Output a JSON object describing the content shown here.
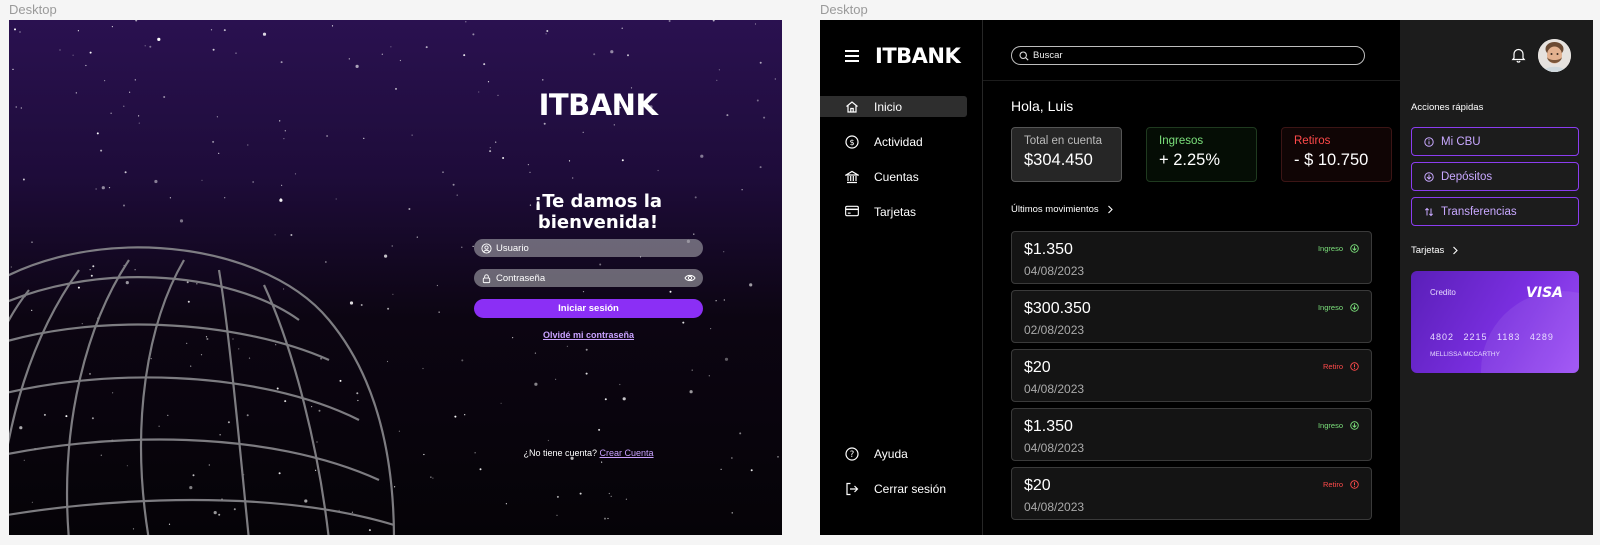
{
  "frames": {
    "left_label": "Desktop",
    "right_label": "Desktop"
  },
  "login": {
    "logo": "ITBANK",
    "welcome": "¡Te damos la bienvenida!",
    "user_placeholder": "Usuario",
    "password_placeholder": "Contraseña",
    "login_button": "Iniciar sesión",
    "forgot_link": "Olvidé mi contraseña",
    "signup_prompt": "¿No tiene cuenta?",
    "signup_link": "Crear Cuenta"
  },
  "dashboard": {
    "logo": "ITBANK",
    "search_placeholder": "Buscar",
    "nav": [
      {
        "label": "Inicio",
        "icon": "home-icon",
        "active": true
      },
      {
        "label": "Actividad",
        "icon": "dollar-circle-icon"
      },
      {
        "label": "Cuentas",
        "icon": "bank-icon"
      },
      {
        "label": "Tarjetas",
        "icon": "credit-card-icon"
      }
    ],
    "nav_bottom": [
      {
        "label": "Ayuda",
        "icon": "help-icon"
      },
      {
        "label": "Cerrar sesión",
        "icon": "logout-icon"
      }
    ],
    "greeting": "Hola, Luis",
    "stats": {
      "total": {
        "label": "Total en cuenta",
        "value": "$304.450"
      },
      "income": {
        "label": "Ingresos",
        "value": "+ 2.25%"
      },
      "withdrawals": {
        "label": "Retiros",
        "value": "- $ 10.750"
      }
    },
    "movements_title": "Últimos movimientos",
    "movements": [
      {
        "amount": "$1.350",
        "date": "04/08/2023",
        "type": "Ingreso"
      },
      {
        "amount": "$300.350",
        "date": "02/08/2023",
        "type": "Ingreso"
      },
      {
        "amount": "$20",
        "date": "04/08/2023",
        "type": "Retiro"
      },
      {
        "amount": "$1.350",
        "date": "04/08/2023",
        "type": "Ingreso"
      },
      {
        "amount": "$20",
        "date": "04/08/2023",
        "type": "Retiro"
      }
    ],
    "quick_actions_title": "Acciones rápidas",
    "quick_actions": [
      {
        "label": "Mi CBU",
        "icon": "info-icon"
      },
      {
        "label": "Depósitos",
        "icon": "deposit-icon"
      },
      {
        "label": "Transferencias",
        "icon": "transfer-icon"
      }
    ],
    "cards_title": "Tarjetas",
    "card": {
      "type": "Credito",
      "brand": "VISA",
      "number": "4802 2215 1183 4289",
      "holder": "MELLISSA MCCARTHY"
    },
    "colors": {
      "accent": "#8b2ff5",
      "income": "#7be07b",
      "withdrawal": "#ff4a4a"
    }
  }
}
